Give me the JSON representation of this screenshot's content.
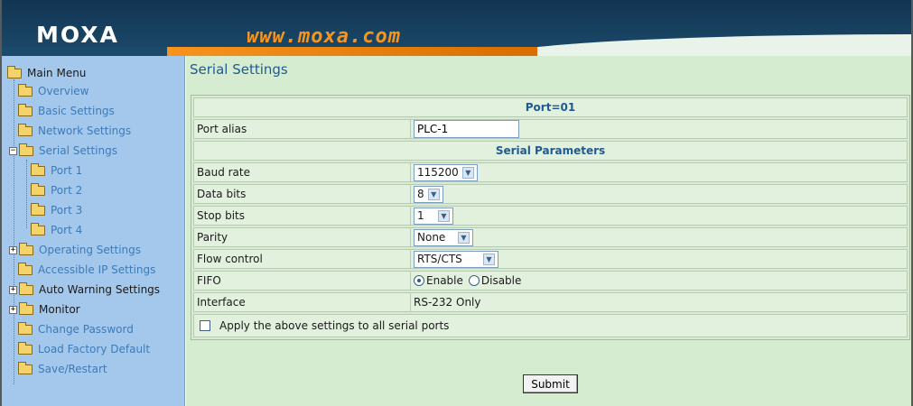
{
  "header": {
    "logo": "MOXA",
    "url": "www.moxa.com"
  },
  "sidebar": {
    "root": "Main Menu",
    "items": [
      {
        "label": "Overview",
        "icon": "folder-icon"
      },
      {
        "label": "Basic Settings",
        "icon": "folder-icon"
      },
      {
        "label": "Network Settings",
        "icon": "folder-icon"
      },
      {
        "label": "Serial Settings",
        "icon": "folder-open-icon",
        "expander": "−"
      },
      {
        "label": "Port 1",
        "icon": "folder-icon"
      },
      {
        "label": "Port 2",
        "icon": "folder-icon"
      },
      {
        "label": "Port 3",
        "icon": "folder-icon"
      },
      {
        "label": "Port 4",
        "icon": "folder-icon"
      },
      {
        "label": "Operating Settings",
        "icon": "folder-icon",
        "expander": "+"
      },
      {
        "label": "Accessible IP Settings",
        "icon": "folder-icon"
      },
      {
        "label": "Auto Warning Settings",
        "icon": "folder-icon",
        "expander": "+"
      },
      {
        "label": "Monitor",
        "icon": "folder-icon",
        "expander": "+"
      },
      {
        "label": "Change Password",
        "icon": "folder-icon"
      },
      {
        "label": "Load Factory Default",
        "icon": "folder-icon"
      },
      {
        "label": "Save/Restart",
        "icon": "folder-icon"
      }
    ]
  },
  "main": {
    "title": "Serial Settings",
    "port_header": "Port=01",
    "port_alias_label": "Port alias",
    "port_alias_value": "PLC-1",
    "serial_params_header": "Serial Parameters",
    "baud_rate_label": "Baud rate",
    "baud_rate_value": "115200",
    "data_bits_label": "Data bits",
    "data_bits_value": "8",
    "stop_bits_label": "Stop bits",
    "stop_bits_value": "1",
    "parity_label": "Parity",
    "parity_value": "None",
    "flow_control_label": "Flow control",
    "flow_control_value": "RTS/CTS",
    "fifo_label": "FIFO",
    "fifo_enable": "Enable",
    "fifo_disable": "Disable",
    "fifo_selected": "Enable",
    "interface_label": "Interface",
    "interface_value": "RS-232 Only",
    "apply_all_label": "Apply the above settings to all serial ports",
    "submit_label": "Submit"
  },
  "colors": {
    "header_bg": "#1c4a6b",
    "accent_orange": "#f7941d",
    "sidebar_bg": "#a4c8ec",
    "main_bg": "#d5ecd0",
    "link_blue": "#3e7ab6"
  }
}
